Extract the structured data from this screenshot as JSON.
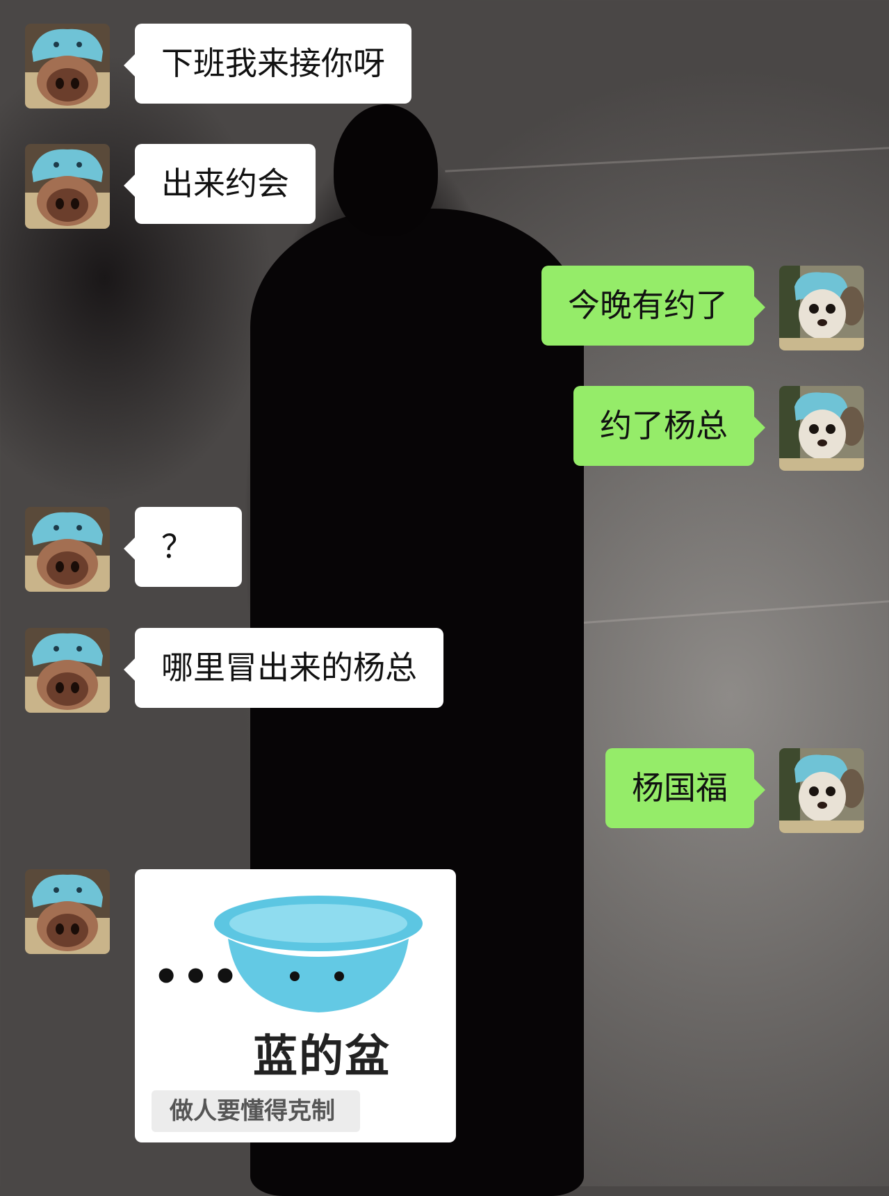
{
  "conversation": {
    "messages": [
      {
        "side": "left",
        "text": "下班我来接你呀"
      },
      {
        "side": "left",
        "text": "出来约会"
      },
      {
        "side": "right",
        "text": "今晚有约了"
      },
      {
        "side": "right",
        "text": "约了杨总"
      },
      {
        "side": "left",
        "text": "？"
      },
      {
        "side": "left",
        "text": "哪里冒出来的杨总"
      },
      {
        "side": "right",
        "text": "杨国福"
      }
    ],
    "sticker": {
      "dots": "•••",
      "title": "蓝的盆",
      "caption": "做人要懂得克制"
    }
  },
  "avatars": {
    "other": "puppy-blue-hat-closeup-avatar",
    "self": "puppy-blue-hat-avatar"
  }
}
